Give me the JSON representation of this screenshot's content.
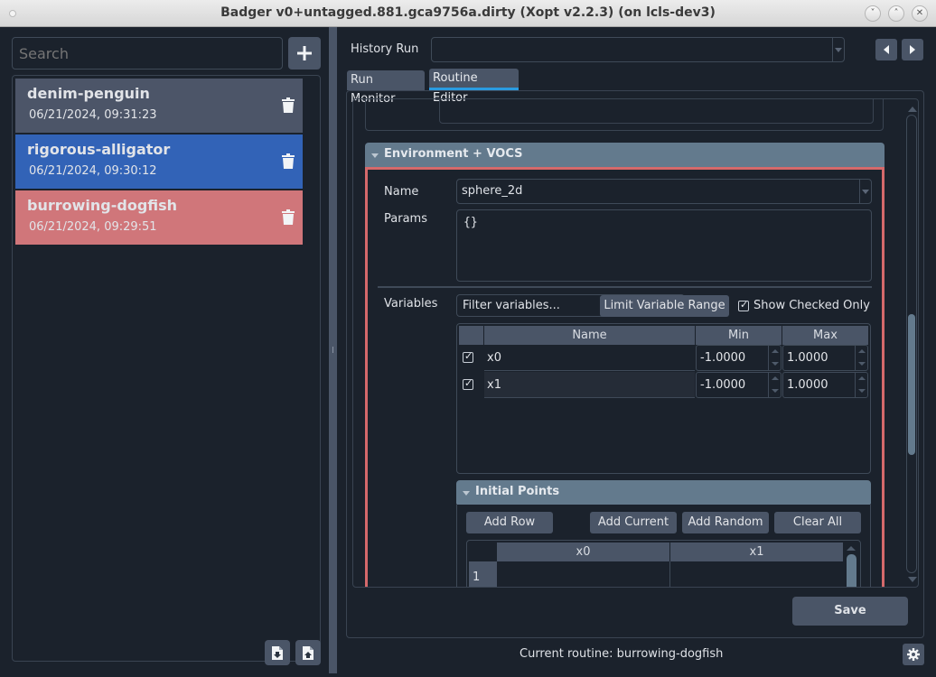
{
  "window": {
    "title": "Badger v0+untagged.881.gca9756a.dirty (Xopt v2.2.3) (on lcls-dev3)",
    "buttons": [
      "minimize",
      "maximize",
      "close"
    ]
  },
  "sidebar": {
    "search": {
      "placeholder": "Search",
      "value": ""
    },
    "add_icon": "plus-icon",
    "routines": [
      {
        "name": "denim-penguin",
        "timestamp": "06/21/2024, 09:31:23",
        "color": "#4c5568",
        "state": "default"
      },
      {
        "name": "rigorous-alligator",
        "timestamp": "06/21/2024, 09:30:12",
        "color": "#3263b7",
        "state": "hover"
      },
      {
        "name": "burrowing-dogfish",
        "timestamp": "06/21/2024, 09:29:51",
        "color": "#d0767a",
        "state": "selected"
      }
    ],
    "bottom_icons": [
      "import-file-icon",
      "export-file-icon"
    ]
  },
  "header": {
    "history_label": "History Run",
    "history_value": ""
  },
  "tabs": [
    {
      "label": "Run Monitor",
      "active": false
    },
    {
      "label": "Routine Editor",
      "active": true
    }
  ],
  "environment": {
    "section_title": "Environment + VOCS",
    "name_label": "Name",
    "name_value": "sphere_2d",
    "params_label": "Params",
    "params_value": "{}",
    "variables_label": "Variables",
    "filter_placeholder": "Filter variables...",
    "limit_button": "Limit Variable Range",
    "show_checked_label": "Show Checked Only",
    "show_checked": true,
    "var_columns": [
      "",
      "Name",
      "Min",
      "Max"
    ],
    "variables": [
      {
        "checked": true,
        "name": "x0",
        "min": "-1.0000",
        "max": "1.0000"
      },
      {
        "checked": true,
        "name": "x1",
        "min": "-1.0000",
        "max": "1.0000"
      }
    ]
  },
  "initial_points": {
    "section_title": "Initial Points",
    "buttons": [
      "Add Row",
      "Add Current",
      "Add Random",
      "Clear All"
    ],
    "columns": [
      "x0",
      "x1"
    ],
    "rows": [
      {
        "index": "1",
        "values": [
          "",
          ""
        ]
      }
    ]
  },
  "footer": {
    "save_label": "Save",
    "current_routine_text": "Current routine: burrowing-dogfish"
  },
  "colors": {
    "background": "#1b222c",
    "button": "#4a5567",
    "section_header": "#637a8d",
    "accent_tab": "#2a9be0",
    "highlight_border": "#d5696b"
  }
}
